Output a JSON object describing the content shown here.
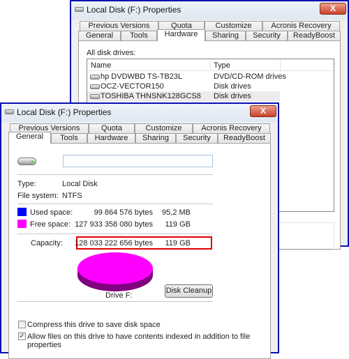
{
  "back_window": {
    "title": "Local Disk (F:) Properties",
    "close_label": "X",
    "tabs_row1": [
      "Previous Versions",
      "Quota",
      "Customize",
      "Acronis Recovery"
    ],
    "tabs_row2": [
      "General",
      "Tools",
      "Hardware",
      "Sharing",
      "Security",
      "ReadyBoost"
    ],
    "selected_tab": "Hardware",
    "drives_label": "All disk drives:",
    "columns": [
      "Name",
      "Type"
    ],
    "rows": [
      {
        "name": "hp DVDWBD TS-TB23L",
        "type": "DVD/CD-ROM drives",
        "icon": "dvd-drive-icon"
      },
      {
        "name": "OCZ-VECTOR150",
        "type": "Disk drives",
        "icon": "hard-drive-icon"
      },
      {
        "name": "TOSHIBA THNSNK128GCS8",
        "type": "Disk drives",
        "icon": "hard-drive-icon",
        "selected": true
      }
    ]
  },
  "front_window": {
    "title": "Local Disk (F:) Properties",
    "close_label": "X",
    "tabs_row1": [
      "Previous Versions",
      "Quota",
      "Customize",
      "Acronis Recovery"
    ],
    "tabs_row2": [
      "General",
      "Tools",
      "Hardware",
      "Sharing",
      "Security",
      "ReadyBoost"
    ],
    "selected_tab": "General",
    "name_value": "",
    "type_label": "Type:",
    "type_value": "Local Disk",
    "fs_label": "File system:",
    "fs_value": "NTFS",
    "used": {
      "label": "Used space:",
      "bytes": "99 864 576 bytes",
      "size": "95,2 MB",
      "color": "#0000ff"
    },
    "free": {
      "label": "Free space:",
      "bytes": "127 933 358 080 bytes",
      "size": "119 GB",
      "color": "#ff00ff"
    },
    "capacity": {
      "label": "Capacity:",
      "bytes": "128 033 222 656 bytes",
      "size": "119 GB",
      "highlight_color": "#e00000"
    },
    "drive_label": "Drive F:",
    "disk_cleanup_label": "Disk Cleanup",
    "compress_label": "Compress this drive to save disk space",
    "compress_checked": false,
    "index_label_line1": "Allow files on this drive to have contents indexed in addition to file",
    "index_label_line2": "properties",
    "index_checked": true
  },
  "chart_data": {
    "type": "pie",
    "categories": [
      "Used space",
      "Free space"
    ],
    "values": [
      99864576,
      127933358080
    ],
    "colors": [
      "#0000ff",
      "#ff00ff"
    ]
  }
}
